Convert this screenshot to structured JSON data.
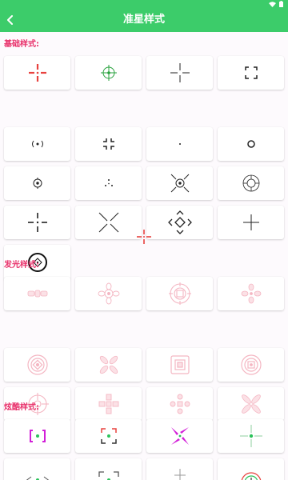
{
  "header": {
    "title": "准星样式"
  },
  "sections": [
    {
      "label": "基础样式:"
    },
    {
      "label": "发光样式:"
    },
    {
      "label": "炫酷样式:"
    }
  ],
  "colors": {
    "header_bg": "#3ccc6a",
    "section_label": "#e8306a",
    "selected_crosshair": "#e8423f",
    "glow": "#f4b6c2",
    "cool_magenta": "#d21fd8",
    "cool_green": "#2bc25a"
  },
  "icons": {
    "back": "chevron-left-icon",
    "wifi": "wifi-icon",
    "battery": "battery-icon"
  },
  "basic_styles": [
    "crosshair-red-gap",
    "crosshair-green-circle",
    "crosshair-thin-cross",
    "crosshair-corner-brackets",
    "crosshair-dot-parens",
    "crosshair-corner-ticks",
    "crosshair-small-dot",
    "crosshair-ring",
    "crosshair-circle-dot",
    "crosshair-triangle-dots",
    "crosshair-x-circle",
    "crosshair-double-ring",
    "crosshair-dashed-cross",
    "crosshair-x-lines",
    "crosshair-diamond-arrows",
    "crosshair-plus",
    "crosshair-dark-ring-diamond"
  ],
  "glow_styles": [
    "glow-bars",
    "glow-flower",
    "glow-target-ring",
    "glow-petals",
    "glow-concentric",
    "glow-x-petals",
    "glow-square-ring",
    "glow-circle-square",
    "glow-crosshair-ring",
    "glow-cross-blocks",
    "glow-dot-cross",
    "glow-x-star"
  ],
  "cool_styles": [
    "cool-bracket-dot",
    "cool-corner-dot",
    "cool-pinwheel",
    "cool-green-cross",
    "cool-partial-1",
    "cool-partial-2",
    "cool-partial-3",
    "cool-partial-4"
  ]
}
